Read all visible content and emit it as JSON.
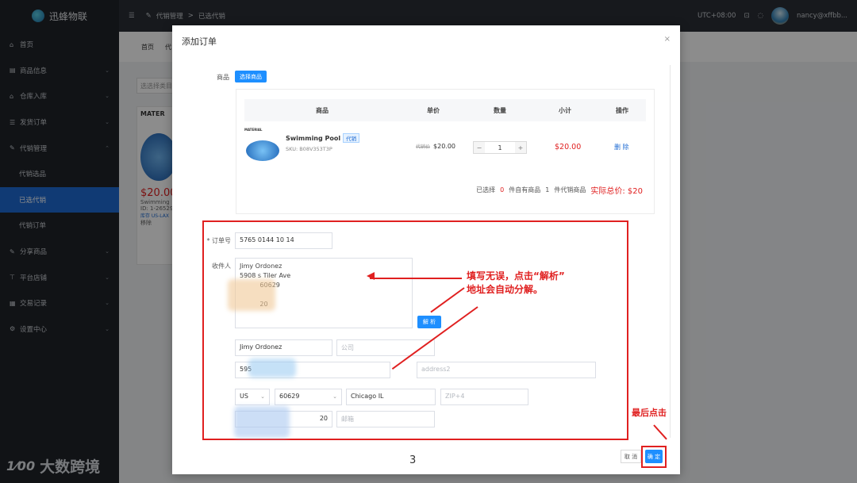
{
  "sidebar": {
    "logo": "迅蜂物联",
    "items": [
      {
        "label": "首页",
        "icon": "home-icon",
        "chev": ""
      },
      {
        "label": "商品信息",
        "icon": "box-icon",
        "chev": "⌄"
      },
      {
        "label": "仓库入库",
        "icon": "warehouse-icon",
        "chev": "⌄"
      },
      {
        "label": "发货订单",
        "icon": "list-icon",
        "chev": "⌄"
      },
      {
        "label": "代销管理",
        "icon": "edit-icon",
        "chev": "⌃"
      },
      {
        "label": "代销选品",
        "icon": "",
        "chev": "",
        "sub": true
      },
      {
        "label": "已选代销",
        "icon": "",
        "chev": "",
        "sub": true,
        "active": true
      },
      {
        "label": "代销订单",
        "icon": "",
        "chev": "",
        "sub": true
      },
      {
        "label": "分享商品",
        "icon": "share-icon",
        "chev": "⌄"
      },
      {
        "label": "平台店铺",
        "icon": "store-icon",
        "chev": "⌄"
      },
      {
        "label": "交易记录",
        "icon": "record-icon",
        "chev": "⌄"
      },
      {
        "label": "设置中心",
        "icon": "gear-icon",
        "chev": "⌄"
      }
    ],
    "watermark": "大数跨境",
    "watermark_mark": "1⁄00"
  },
  "topbar": {
    "breadcrumb_1": "代销管理",
    "breadcrumb_sep": ">",
    "breadcrumb_2": "已选代销",
    "timezone": "UTC+08:00",
    "user": "nancy@xffbb..."
  },
  "page_bg": {
    "tab_home": "首页",
    "tab_2": "代",
    "search_placeholder": "选选择类目",
    "card_title": "MATER",
    "card_price": "$20.00",
    "card_name": "Swimming",
    "card_id": "ID: 1-26529",
    "card_tag": "库存 US-LAX",
    "card_btn": "移除"
  },
  "modal": {
    "title": "添加订单",
    "close": "×",
    "goods_label": "商品",
    "select_goods_btn": "选择商品",
    "table": {
      "headers": [
        "商品",
        "单价",
        "数量",
        "小计",
        "操作"
      ],
      "row": {
        "thumb_label": "MATERIAL",
        "name": "Swimming Pool",
        "tag": "代销",
        "sku": "SKU: B08V353T3P",
        "old_price": "代销价",
        "price": "$20.00",
        "qty": "1",
        "minus": "−",
        "plus": "+",
        "subtotal": "$20.00",
        "action": "删 除"
      }
    },
    "summary": {
      "prefix": "已选择",
      "own_count": "0",
      "mid": "件自有商品",
      "consign_count": "1",
      "suffix": "件代销商品",
      "total": "实际总价: $20"
    },
    "order_no_label": "* 订单号",
    "order_no_value": "5765 0144  10 14",
    "recipient_label": "收件人",
    "recipient_text": "Jimy Ordonez\n5908 s Tiler Ave\n          60629\n\n          20",
    "parse_btn": "解 析",
    "fields": {
      "name_value": "Jimy Ordonez",
      "company_placeholder": "公司",
      "address1_value": "595",
      "address2_placeholder": "address2",
      "country_value": "US",
      "zip_value": "60629",
      "city_value": "Chicago IL",
      "zip4_placeholder": "ZIP+4",
      "phone_value": "20",
      "email_placeholder": "邮箱"
    },
    "page_number": "3",
    "cancel_btn": "取 消",
    "confirm_btn": "确 定"
  },
  "annotations": {
    "parse_hint_line1": "填写无误，点击“解析”",
    "parse_hint_line2": "地址会自动分解。",
    "final_hint": "最后点击"
  },
  "colors": {
    "accent": "#1e8fff",
    "annotation_red": "#e02020",
    "sidebar_bg": "#1f2329"
  }
}
